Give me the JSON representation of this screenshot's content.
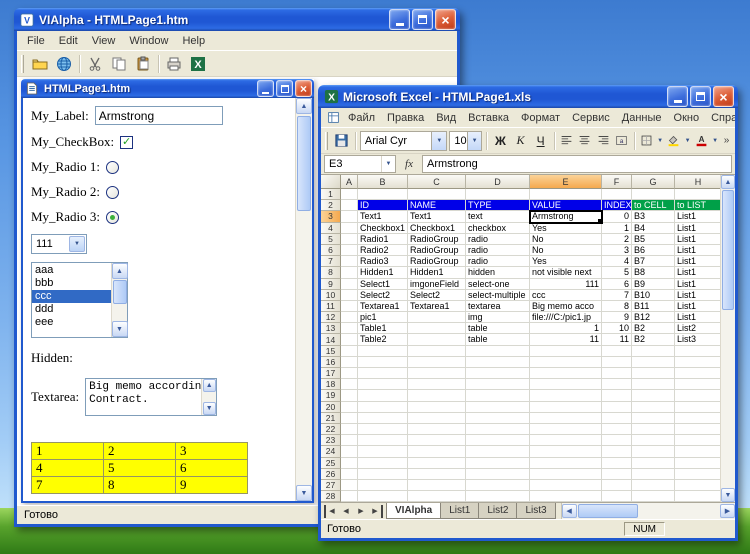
{
  "vialpha": {
    "title": "VIAlpha - HTMLPage1.htm",
    "menu": [
      "File",
      "Edit",
      "View",
      "Window",
      "Help"
    ],
    "status": "Готово",
    "child": {
      "title": "HTMLPage1.htm",
      "form": {
        "label_caption": "My_Label:",
        "label_value": "Armstrong",
        "checkbox_caption": "My_CheckBox:",
        "checkbox_checked": true,
        "radio1_caption": "My_Radio 1:",
        "radio2_caption": "My_Radio 2:",
        "radio3_caption": "My_Radio 3:",
        "radio_checked": "My_Radio 3",
        "select_value": "111",
        "list_items": [
          "aaa",
          "bbb",
          "ccc",
          "ddd",
          "eee"
        ],
        "list_selected": "ccc",
        "hidden_caption": "Hidden:",
        "textarea_caption": "Textarea:",
        "textarea_line1": "Big memo according",
        "textarea_line2": "Contract.",
        "table_rows": [
          [
            "1",
            "2",
            "3"
          ],
          [
            "4",
            "5",
            "6"
          ],
          [
            "7",
            "8",
            "9"
          ]
        ]
      }
    }
  },
  "excel": {
    "title": "Microsoft Excel - HTMLPage1.xls",
    "menu": [
      "Файл",
      "Правка",
      "Вид",
      "Вставка",
      "Формат",
      "Сервис",
      "Данные",
      "Окно",
      "Справка"
    ],
    "toolbar": {
      "font_name": "Arial Cyr",
      "font_size": "10",
      "bold": "Ж",
      "italic": "К",
      "underline": "Ч"
    },
    "name_box": "E3",
    "fx_label": "fx",
    "formula_value": "Armstrong",
    "columns": [
      "A",
      "B",
      "C",
      "D",
      "E",
      "F",
      "G",
      "H"
    ],
    "row_count": 28,
    "selected": {
      "col": "E",
      "row": 3
    },
    "rows": [
      {
        "r": 2,
        "style": "header",
        "B": "ID",
        "C": "NAME",
        "D": "TYPE",
        "E": "VALUE",
        "F": "INDEX",
        "G": "to CELL",
        "H": "to LIST"
      },
      {
        "r": 3,
        "B": "Text1",
        "C": "Text1",
        "D": "text",
        "E": "Armstrong",
        "F": "0",
        "G": "B3",
        "H": "List1"
      },
      {
        "r": 4,
        "B": "Checkbox1",
        "C": "Checkbox1",
        "D": "checkbox",
        "E": "Yes",
        "F": "1",
        "G": "B4",
        "H": "List1"
      },
      {
        "r": 5,
        "B": "Radio1",
        "C": "RadioGroup",
        "D": "radio",
        "E": "No",
        "F": "2",
        "G": "B5",
        "H": "List1"
      },
      {
        "r": 6,
        "B": "Radio2",
        "C": "RadioGroup",
        "D": "radio",
        "E": "No",
        "F": "3",
        "G": "B6",
        "H": "List1"
      },
      {
        "r": 7,
        "B": "Radio3",
        "C": "RadioGroup",
        "D": "radio",
        "E": "Yes",
        "F": "4",
        "G": "B7",
        "H": "List1"
      },
      {
        "r": 8,
        "B": "Hidden1",
        "C": "Hidden1",
        "D": "hidden",
        "E": "not visible next",
        "F": "5",
        "G": "B8",
        "H": "List1"
      },
      {
        "r": 9,
        "B": "Select1",
        "C": "imgoneField",
        "D": "select-one",
        "E": "111",
        "E_align": "right",
        "F": "6",
        "G": "B9",
        "H": "List1"
      },
      {
        "r": 10,
        "B": "Select2",
        "C": "Select2",
        "D": "select-multiple",
        "E": "ccc",
        "F": "7",
        "G": "B10",
        "H": "List1"
      },
      {
        "r": 11,
        "B": "Textarea1",
        "C": "Textarea1",
        "D": "textarea",
        "E": "Big memo acco",
        "F": "8",
        "G": "B11",
        "H": "List1"
      },
      {
        "r": 12,
        "B": "pic1",
        "D": "img",
        "E": "file:///C:/pic1.jp",
        "F": "9",
        "G": "B12",
        "H": "List1"
      },
      {
        "r": 13,
        "B": "Table1",
        "D": "table",
        "E": "1",
        "E_align": "right",
        "F": "10",
        "G": "B2",
        "H": "List2"
      },
      {
        "r": 14,
        "B": "Table2",
        "D": "table",
        "E": "11",
        "E_align": "right",
        "F": "11",
        "G": "B2",
        "H": "List3"
      }
    ],
    "sheet_tabs": [
      "VIAlpha",
      "List1",
      "List2",
      "List3"
    ],
    "active_tab": "VIAlpha",
    "status_ready": "Готово",
    "status_num": "NUM"
  }
}
